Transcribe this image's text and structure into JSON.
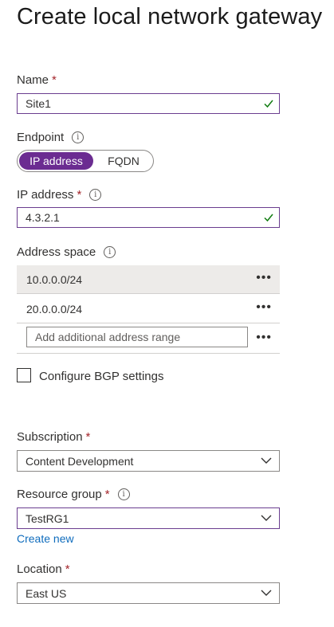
{
  "page": {
    "title": "Create local network gateway"
  },
  "name": {
    "label": "Name",
    "value": "Site1"
  },
  "endpoint": {
    "label": "Endpoint",
    "options": [
      "IP address",
      "FQDN"
    ],
    "selected": "IP address"
  },
  "ip_address": {
    "label": "IP address",
    "value": "4.3.2.1"
  },
  "address_space": {
    "label": "Address space",
    "rows": [
      "10.0.0.0/24",
      "20.0.0.0/24"
    ],
    "add_placeholder": "Add additional address range",
    "more_icon": "•••"
  },
  "bgp": {
    "label": "Configure BGP settings",
    "checked": false
  },
  "subscription": {
    "label": "Subscription",
    "value": "Content Development"
  },
  "resource_group": {
    "label": "Resource group",
    "value": "TestRG1",
    "create_new": "Create new"
  },
  "location": {
    "label": "Location",
    "value": "East US"
  },
  "common": {
    "required_mark": "*",
    "info_icon": "i"
  },
  "colors": {
    "accent": "#6b2c91",
    "required": "#a4262c",
    "valid": "#107c10",
    "link": "#0f6cbd"
  }
}
